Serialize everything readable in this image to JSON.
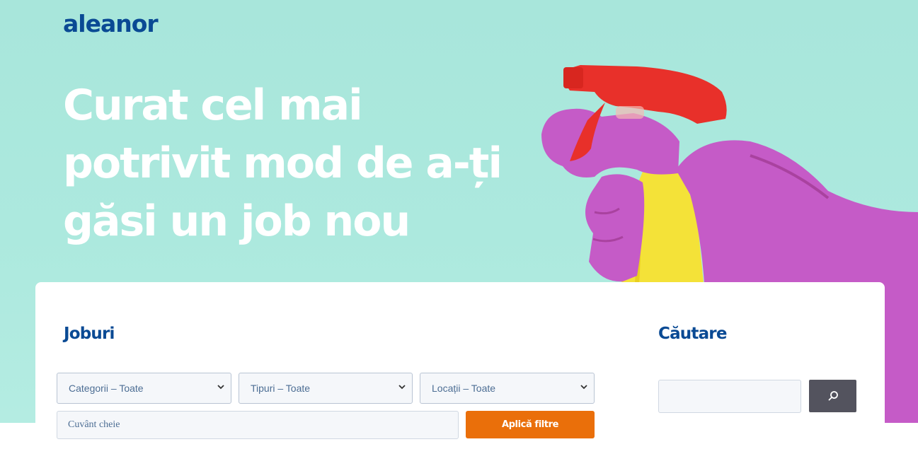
{
  "brand": {
    "logo": "aleanor"
  },
  "hero": {
    "headline": "Curat cel mai potrivit mod de a-ți găsi un job nou"
  },
  "jobs": {
    "title": "Joburi",
    "filters": {
      "category": "Categorii – Toate",
      "type": "Tipuri – Toate",
      "location": "Locații – Toate"
    },
    "keyword_placeholder": "Cuvânt cheie",
    "apply_label": "Aplică filtre"
  },
  "search": {
    "title": "Căutare"
  },
  "colors": {
    "brand": "#0a4a94",
    "hero_bg": "#a8e6db",
    "apply_button": "#ea6f0a",
    "search_button": "#53535e",
    "glove": "#c55bc7",
    "spray_head": "#e8302a",
    "bottle": "#f4e238"
  },
  "icons": {
    "search_button": "search-icon",
    "dropdown": "chevron-down-icon"
  }
}
